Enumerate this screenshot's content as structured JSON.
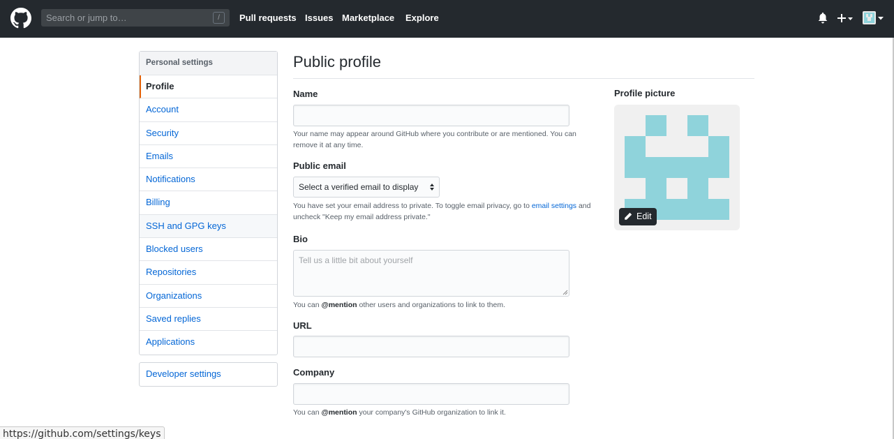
{
  "header": {
    "search_placeholder": "Search or jump to…",
    "search_shortcut": "/",
    "nav": [
      "Pull requests",
      "Issues",
      "Marketplace",
      "Explore"
    ],
    "icons": [
      "github-logo-icon",
      "bell-icon",
      "plus-icon",
      "avatar-icon"
    ]
  },
  "sidebar": {
    "heading": "Personal settings",
    "items": [
      {
        "label": "Profile"
      },
      {
        "label": "Account"
      },
      {
        "label": "Security"
      },
      {
        "label": "Emails"
      },
      {
        "label": "Notifications"
      },
      {
        "label": "Billing"
      },
      {
        "label": "SSH and GPG keys"
      },
      {
        "label": "Blocked users"
      },
      {
        "label": "Repositories"
      },
      {
        "label": "Organizations"
      },
      {
        "label": "Saved replies"
      },
      {
        "label": "Applications"
      }
    ],
    "developer": "Developer settings"
  },
  "main": {
    "title": "Public profile",
    "name": {
      "label": "Name",
      "value": "",
      "note": "Your name may appear around GitHub where you contribute or are mentioned. You can remove it at any time."
    },
    "public_email": {
      "label": "Public email",
      "selected": "Select a verified email to display",
      "note_before": "You have set your email address to private. To toggle email privacy, go to ",
      "note_link": "email settings",
      "note_after": " and uncheck \"Keep my email address private.\""
    },
    "bio": {
      "label": "Bio",
      "placeholder": "Tell us a little bit about yourself",
      "note_before": "You can ",
      "note_mention": "@mention",
      "note_after": " other users and organizations to link to them."
    },
    "url": {
      "label": "URL",
      "value": ""
    },
    "company": {
      "label": "Company",
      "value": "",
      "note_before": "You can ",
      "note_mention": "@mention",
      "note_after": " your company's GitHub organization to link it."
    }
  },
  "profile_picture": {
    "label": "Profile picture",
    "edit_label": "Edit"
  },
  "status_bar": {
    "url": "https://github.com/settings/keys"
  },
  "colors": {
    "header_bg": "#24292e",
    "link": "#0366d6",
    "selected_accent": "#e36209",
    "avatar": "#8fd3db"
  }
}
